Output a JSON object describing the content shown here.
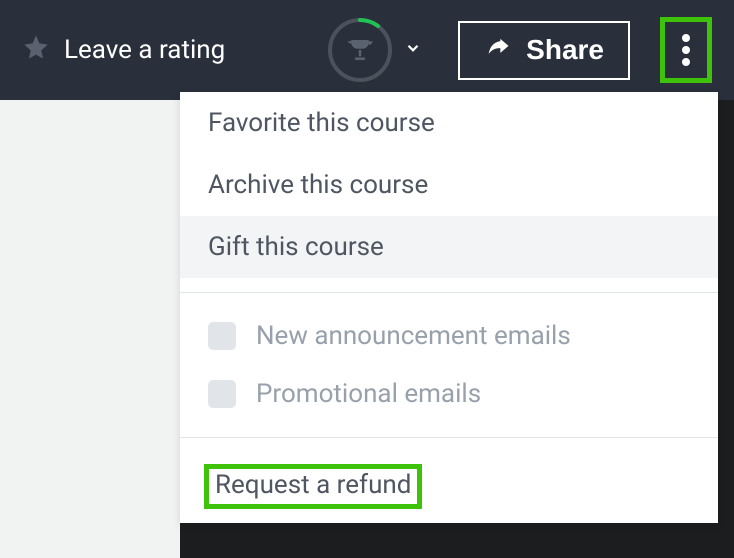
{
  "header": {
    "rating_label": "Leave a rating",
    "share_label": "Share"
  },
  "dropdown": {
    "items": [
      {
        "label": "Favorite this course"
      },
      {
        "label": "Archive this course"
      },
      {
        "label": "Gift this course"
      }
    ],
    "checks": [
      {
        "label": "New announcement emails"
      },
      {
        "label": "Promotional emails"
      }
    ],
    "refund_label": "Request a refund"
  }
}
